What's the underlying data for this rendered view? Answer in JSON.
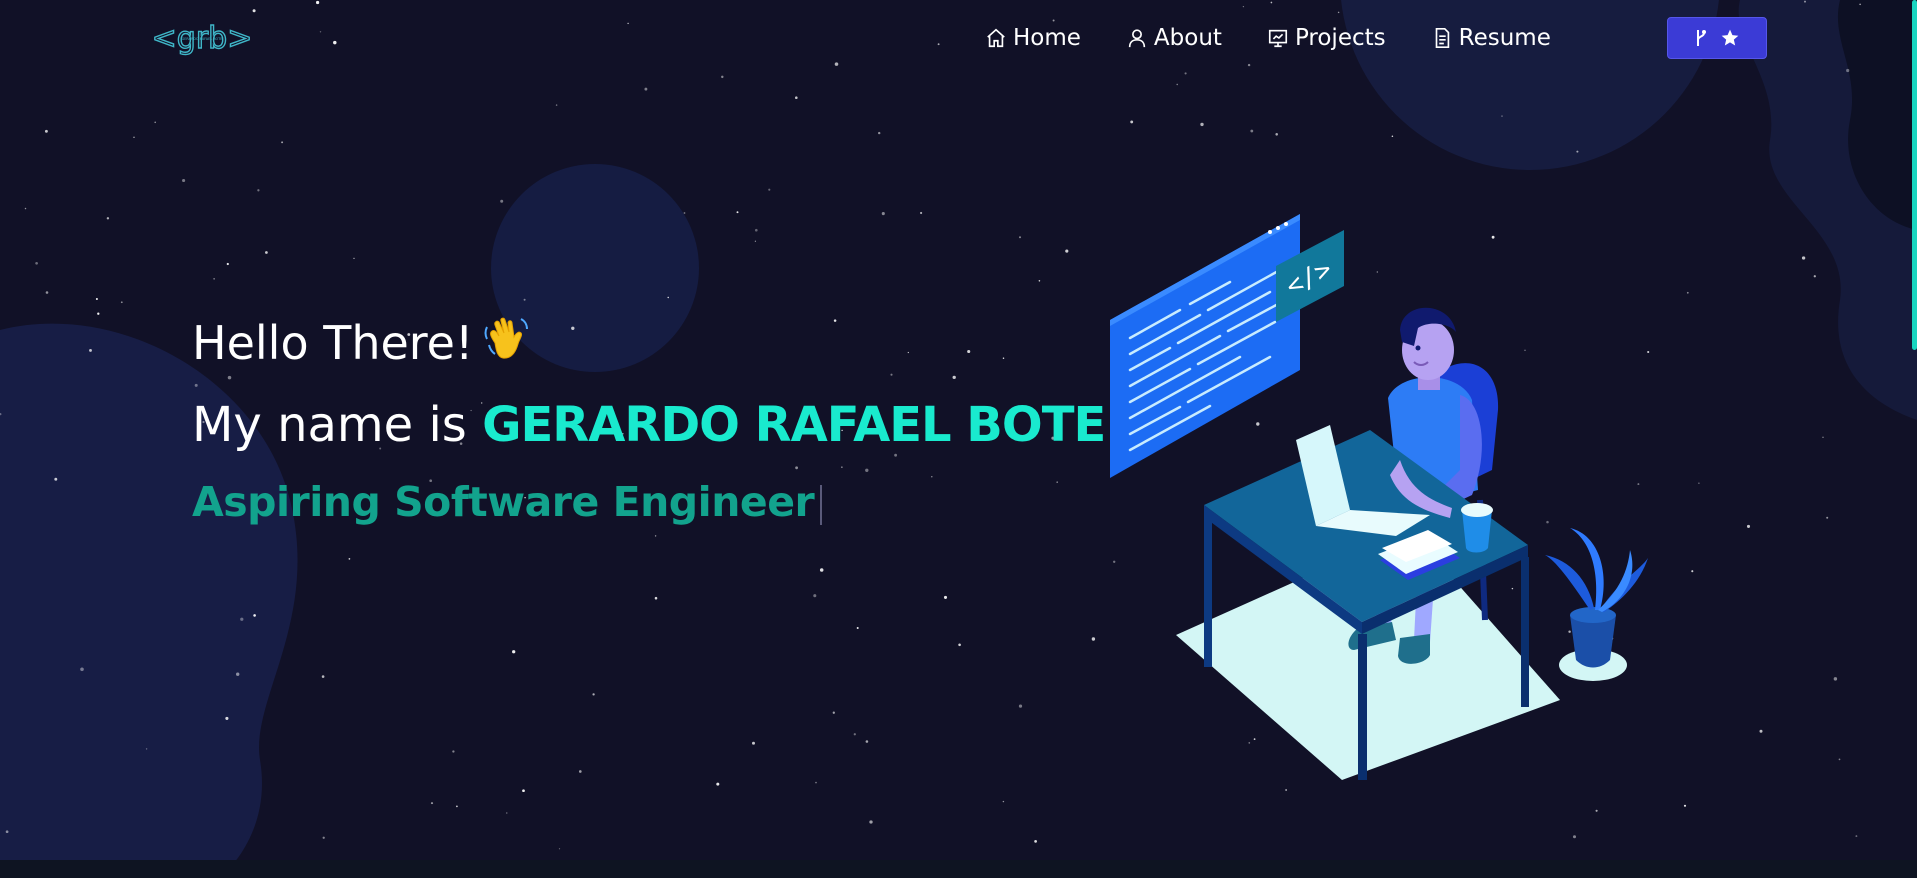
{
  "brand": {
    "logo_text": "<grb>",
    "logo_subtext": "GERARDO RAFAEL BOTE",
    "accent_color": "#19eace"
  },
  "nav": {
    "items": [
      {
        "label": "Home",
        "icon": "home-icon"
      },
      {
        "label": "About",
        "icon": "user-icon"
      },
      {
        "label": "Projects",
        "icon": "presentation-icon"
      },
      {
        "label": "Resume",
        "icon": "document-icon"
      }
    ],
    "github_button": {
      "icons": [
        "git-branch-icon",
        "star-icon"
      ]
    }
  },
  "hero": {
    "greeting": "Hello There!",
    "name_prefix": "My name is ",
    "name": "GERARDO RAFAEL BOTE",
    "name_suffix": ".",
    "role": "Aspiring Software Engineer"
  },
  "colors": {
    "background": "#111127",
    "role_text": "#12a38d",
    "button": "#3b3bd6"
  }
}
